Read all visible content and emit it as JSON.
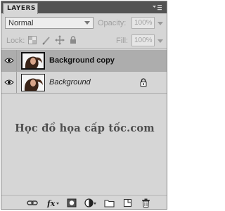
{
  "panel": {
    "tab_label": "LAYERS",
    "menu_icon": "panel-menu-icon"
  },
  "blend": {
    "mode": "Normal",
    "opacity_label": "Opacity:",
    "opacity_value": "100%"
  },
  "lock": {
    "label": "Lock:",
    "icons": [
      "lock-transparent-icon",
      "lock-image-icon",
      "lock-position-icon",
      "lock-all-icon"
    ],
    "fill_label": "Fill:",
    "fill_value": "100%"
  },
  "layers": [
    {
      "name": "Background copy",
      "visible": true,
      "selected": true,
      "locked": false
    },
    {
      "name": "Background",
      "visible": true,
      "selected": false,
      "locked": true
    }
  ],
  "watermark": "Học đồ họa cấp tốc.com",
  "footer_icons": [
    "link-icon",
    "fx-icon",
    "mask-icon",
    "adjustment-icon",
    "folder-icon",
    "new-layer-icon",
    "trash-icon"
  ],
  "colors": {
    "panel_bg": "#d6d6d6",
    "titlebar": "#535353",
    "selected_row": "#adadad"
  }
}
